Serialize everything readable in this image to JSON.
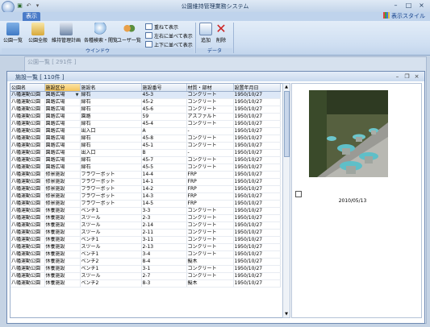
{
  "app": {
    "title": "公園維持管理業務システム",
    "tab": "表示",
    "style_button": "表示スタイル"
  },
  "ribbon": {
    "window_group": {
      "label": "ウインドウ",
      "buttons": [
        "公園一覧",
        "公園全般",
        "維持管理計画",
        "各種検索・閲覧",
        "ユーザ一覧"
      ],
      "arrange": [
        "重ねて表示",
        "左右に並べて表示",
        "上下に並べて表示"
      ]
    },
    "data_group": {
      "label": "データ",
      "buttons": [
        "追加",
        "削除"
      ]
    }
  },
  "background_panel": {
    "title": "公園一覧 [ 291件 ]"
  },
  "facility_window": {
    "title": "施設一覧 [ 110件 ]"
  },
  "grid": {
    "columns": [
      "公園名",
      "施設区分",
      "施設名",
      "施設番号",
      "材質・部材",
      "設置年月日"
    ],
    "rows": [
      [
        "八幡運動公園",
        "園路広場",
        "縁石",
        "45-3",
        "コンクリート",
        "1950/10/27"
      ],
      [
        "八幡運動公園",
        "園路広場",
        "縁石",
        "45-2",
        "コンクリート",
        "1950/10/27"
      ],
      [
        "八幡運動公園",
        "園路広場",
        "縁石",
        "45-6",
        "コンクリート",
        "1950/10/27"
      ],
      [
        "八幡運動公園",
        "園路広場",
        "園路",
        "59",
        "アスファルト",
        "1950/10/27"
      ],
      [
        "八幡運動公園",
        "園路広場",
        "縁石",
        "45-4",
        "コンクリート",
        "1950/10/27"
      ],
      [
        "八幡運動公園",
        "園路広場",
        "出入口",
        "A",
        "-",
        "1950/10/27"
      ],
      [
        "八幡運動公園",
        "園路広場",
        "縁石",
        "45-8",
        "コンクリート",
        "1950/10/27"
      ],
      [
        "八幡運動公園",
        "園路広場",
        "縁石",
        "45-1",
        "コンクリート",
        "1950/10/27"
      ],
      [
        "八幡運動公園",
        "園路広場",
        "出入口",
        "B",
        "-",
        "1950/10/27"
      ],
      [
        "八幡運動公園",
        "園路広場",
        "縁石",
        "45-7",
        "コンクリート",
        "1950/10/27"
      ],
      [
        "八幡運動公園",
        "園路広場",
        "縁石",
        "45-5",
        "コンクリート",
        "1950/10/27"
      ],
      [
        "八幡運動公園",
        "修景施設",
        "フラワーポット",
        "14-4",
        "FRP",
        "1950/10/27"
      ],
      [
        "八幡運動公園",
        "修景施設",
        "フラワーポット",
        "14-1",
        "FRP",
        "1950/10/27"
      ],
      [
        "八幡運動公園",
        "修景施設",
        "フラワーポット",
        "14-2",
        "FRP",
        "1950/10/27"
      ],
      [
        "八幡運動公園",
        "修景施設",
        "フラワーポット",
        "14-3",
        "FRP",
        "1950/10/27"
      ],
      [
        "八幡運動公園",
        "修景施設",
        "フラワーポット",
        "14-5",
        "FRP",
        "1950/10/27"
      ],
      [
        "八幡運動公園",
        "休養施設",
        "ベンチ1",
        "3-3",
        "コンクリート",
        "1950/10/27"
      ],
      [
        "八幡運動公園",
        "休養施設",
        "スツール",
        "2-3",
        "コンクリート",
        "1950/10/27"
      ],
      [
        "八幡運動公園",
        "休養施設",
        "スツール",
        "2-14",
        "コンクリート",
        "1950/10/27"
      ],
      [
        "八幡運動公園",
        "休養施設",
        "スツール",
        "2-11",
        "コンクリート",
        "1950/10/27"
      ],
      [
        "八幡運動公園",
        "休養施設",
        "ベンチ1",
        "3-11",
        "コンクリート",
        "1950/10/27"
      ],
      [
        "八幡運動公園",
        "休養施設",
        "スツール",
        "2-13",
        "コンクリート",
        "1950/10/27"
      ],
      [
        "八幡運動公園",
        "休養施設",
        "ベンチ1",
        "3-4",
        "コンクリート",
        "1950/10/27"
      ],
      [
        "八幡運動公園",
        "休養施設",
        "ベンチ2",
        "8-4",
        "擬木",
        "1950/10/27"
      ],
      [
        "八幡運動公園",
        "休養施設",
        "ベンチ1",
        "3-1",
        "コンクリート",
        "1950/10/27"
      ],
      [
        "八幡運動公園",
        "休養施設",
        "スツール",
        "2-7",
        "コンクリート",
        "1950/10/27"
      ],
      [
        "八幡運動公園",
        "休養施設",
        "ベンチ2",
        "8-3",
        "擬木",
        "1950/10/27"
      ]
    ]
  },
  "preview": {
    "date": "2010/05/13"
  },
  "colors": {
    "accent": "#4a7bc8",
    "ribbon_bg": "#cfdff2",
    "selected_header": "#f5c55c",
    "delete_red": "#cc2222"
  }
}
